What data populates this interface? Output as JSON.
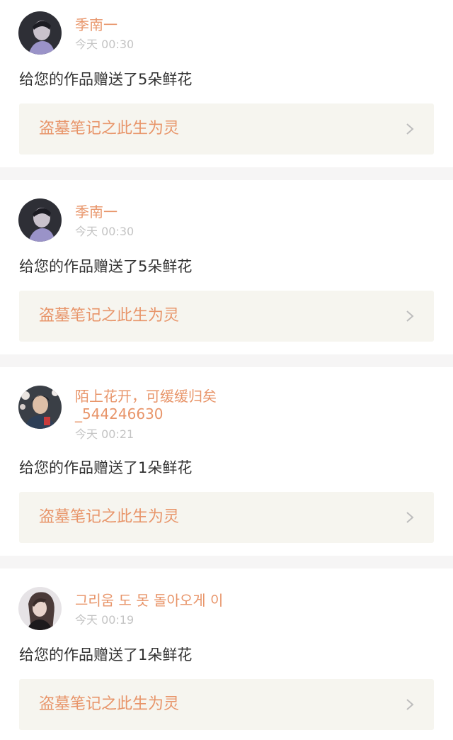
{
  "notifications": [
    {
      "user_name": "季南一",
      "timestamp": "今天 00:30",
      "message": "给您的作品赠送了5朵鲜花",
      "work_title": "盗墓笔记之此生为灵",
      "avatar": "dark-portrait-avatar"
    },
    {
      "user_name": "季南一",
      "timestamp": "今天 00:30",
      "message": "给您的作品赠送了5朵鲜花",
      "work_title": "盗墓笔记之此生为灵",
      "avatar": "dark-portrait-avatar"
    },
    {
      "user_name": "陌上花开，可缓缓归矣",
      "user_name_line2": "_544246630",
      "timestamp": "今天 00:21",
      "message": "给您的作品赠送了1朵鲜花",
      "work_title": "盗墓笔记之此生为灵",
      "avatar": "portrait-with-flowers-avatar"
    },
    {
      "user_name": "그리움 도 못 돌아오게 이",
      "timestamp": "今天 00:19",
      "message": "给您的作品赠送了1朵鲜花",
      "work_title": "盗墓笔记之此生为灵",
      "avatar": "girl-portrait-avatar"
    }
  ],
  "colors": {
    "accent": "#e8956a",
    "timestamp": "#c4c4c4",
    "text": "#333333",
    "link_background": "#f6f5ef",
    "separator": "#f6f5f5"
  }
}
